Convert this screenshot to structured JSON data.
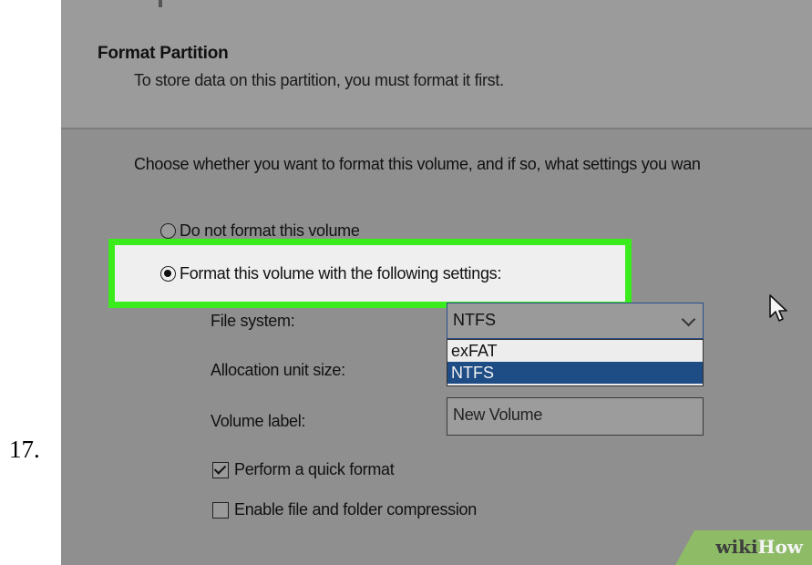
{
  "step_number": "17.",
  "dialog": {
    "title": "Format Partition",
    "subtitle": "To store data on this partition, you must format it first.",
    "instruction": "Choose whether you want to format this volume, and if so, what settings you wan"
  },
  "options": {
    "do_not_format": {
      "label": "Do not format this volume",
      "selected": false
    },
    "format_with_settings": {
      "label": "Format this volume with the following settings:",
      "selected": true
    }
  },
  "fields": {
    "file_system": {
      "label": "File system:",
      "value": "NTFS",
      "dropdown_options": [
        "exFAT",
        "NTFS"
      ],
      "highlighted_option": "NTFS"
    },
    "allocation_unit_size": {
      "label": "Allocation unit size:"
    },
    "volume_label": {
      "label": "Volume label:",
      "value": "New Volume"
    }
  },
  "checkboxes": {
    "quick_format": {
      "label": "Perform a quick format",
      "checked": true
    },
    "compression": {
      "label": "Enable file and folder compression",
      "checked": false
    }
  },
  "watermark": {
    "part1": "wiki",
    "part2": "How"
  },
  "colors": {
    "highlight_border": "#3bec1d",
    "selected_option": "#1e4c85",
    "watermark_bg": "#8dbb66"
  }
}
